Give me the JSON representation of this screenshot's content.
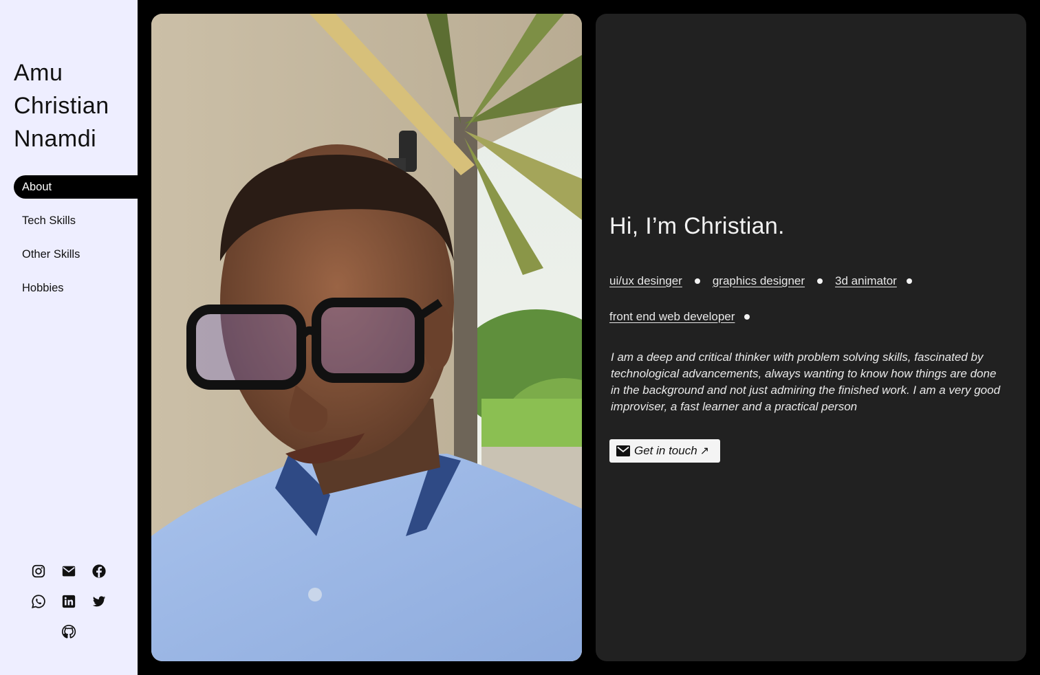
{
  "sidebar": {
    "name_lines": [
      "Amu",
      "Christian",
      "Nnamdi"
    ],
    "nav": [
      {
        "label": "About",
        "active": true
      },
      {
        "label": "Tech Skills",
        "active": false
      },
      {
        "label": "Other Skills",
        "active": false
      },
      {
        "label": "Hobbies",
        "active": false
      }
    ],
    "social_icons": [
      "instagram-icon",
      "mail-icon",
      "facebook-icon",
      "whatsapp-icon",
      "linkedin-icon",
      "twitter-icon",
      "github-icon"
    ]
  },
  "photo": {
    "subject": "portrait-photo"
  },
  "intro": {
    "greeting": "Hi, I’m Christian.",
    "roles": [
      "ui/ux desinger",
      "graphics designer",
      "3d animator",
      "front end web developer"
    ],
    "bio": "I am a deep and critical thinker with problem solving skills, fascinated by technological advancements, always wanting to know how things are done in the background and not just admiring the finished work. I am a very good improviser, a fast learner and a practical person",
    "cta_label": "Get in touch",
    "cta_arrow": "↗"
  },
  "colors": {
    "sidebar_bg": "#eeeeff",
    "page_bg": "#000000",
    "card_bg": "#212121",
    "text_light": "#f2f2f2"
  }
}
